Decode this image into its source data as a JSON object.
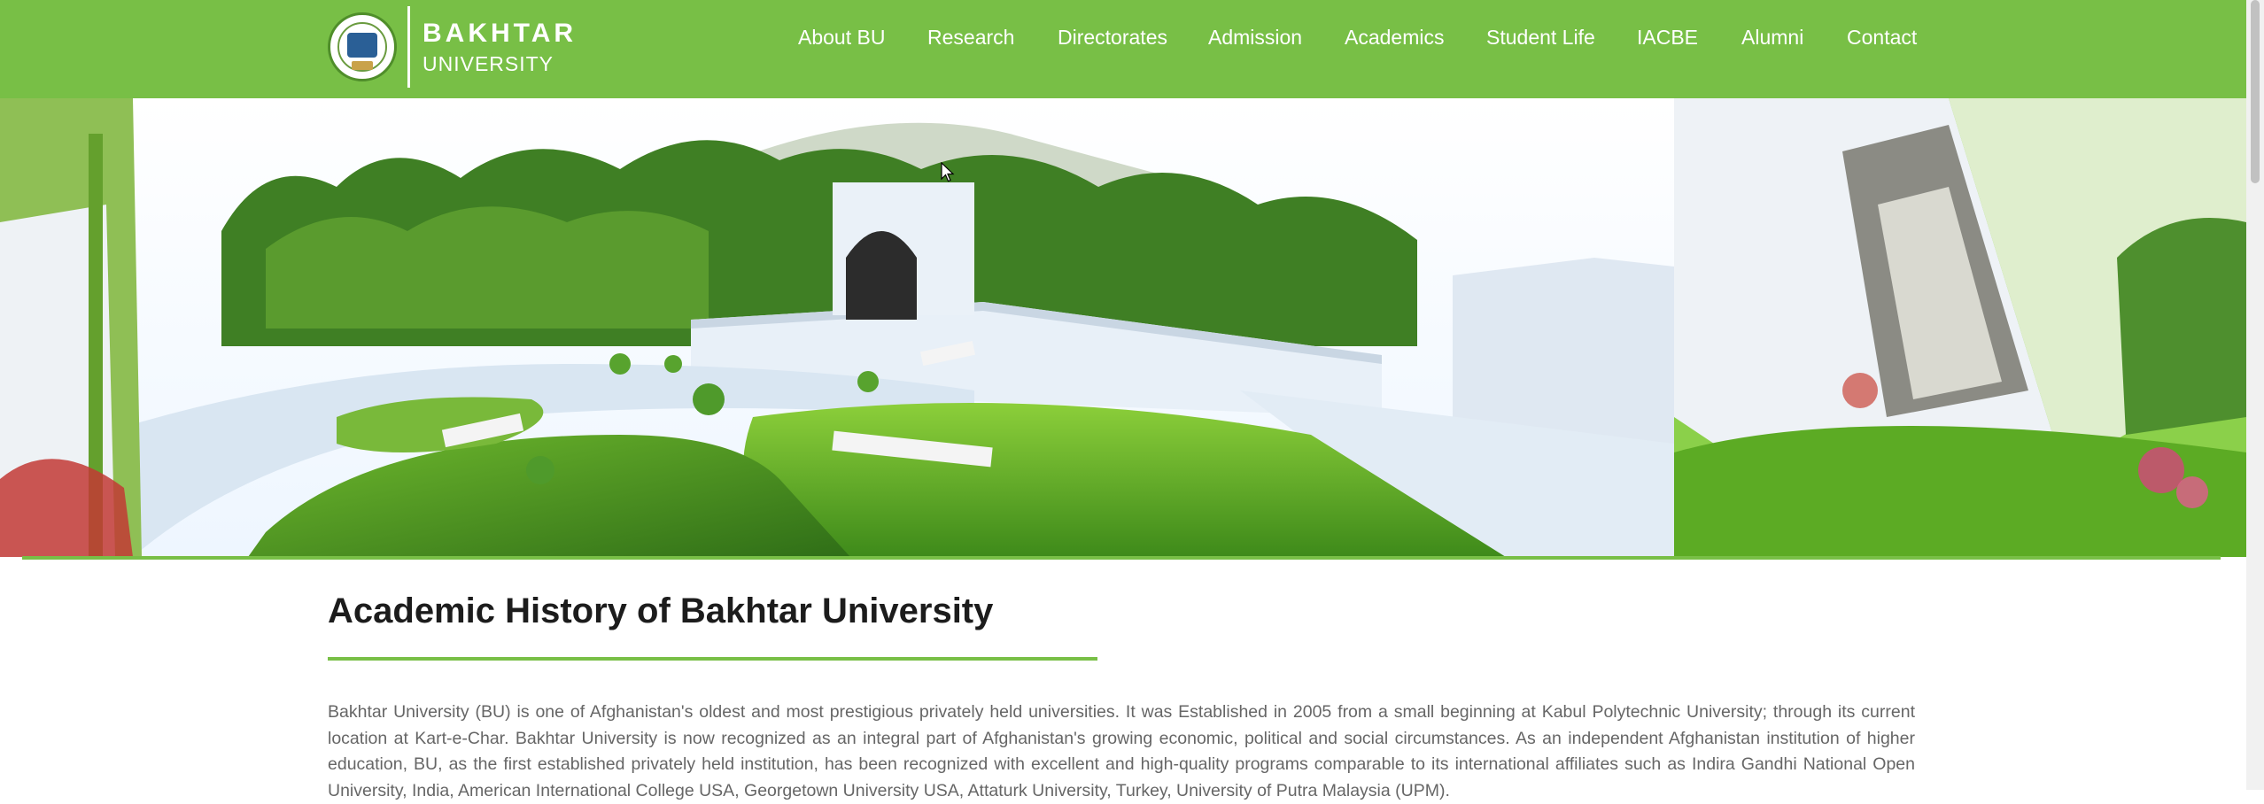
{
  "header": {
    "logo": {
      "name_line1": "BAKHTAR",
      "name_line2": "UNIVERSITY",
      "seal_icon": "university-seal-icon"
    },
    "nav": [
      {
        "label": "About BU"
      },
      {
        "label": "Research"
      },
      {
        "label": "Directorates"
      },
      {
        "label": "Admission"
      },
      {
        "label": "Academics"
      },
      {
        "label": "Student Life"
      },
      {
        "label": "IACBE"
      },
      {
        "label": "Alumni"
      },
      {
        "label": "Contact"
      }
    ]
  },
  "hero": {
    "image": "campus-panorama-photo"
  },
  "content": {
    "title": "Academic History of Bakhtar University",
    "paragraph": "Bakhtar University (BU) is one of Afghanistan's oldest and most prestigious privately held universities. It was Established in 2005 from a small beginning at Kabul Polytechnic University; through its current location at Kart-e-Char. Bakhtar University is now recognized as an integral part of Afghanistan's growing economic, political and social circumstances. As an independent Afghanistan institution of higher education, BU, as the first established privately held institution, has been recognized with excellent and high-quality programs comparable to its international affiliates such as Indira Gandhi National Open University, India, American International College USA, Georgetown University USA, Attaturk University, Turkey, University of Putra Malaysia (UPM)."
  },
  "colors": {
    "brand_green": "#78bf46",
    "heading_text": "#1c1c1c",
    "body_text": "#666666"
  }
}
